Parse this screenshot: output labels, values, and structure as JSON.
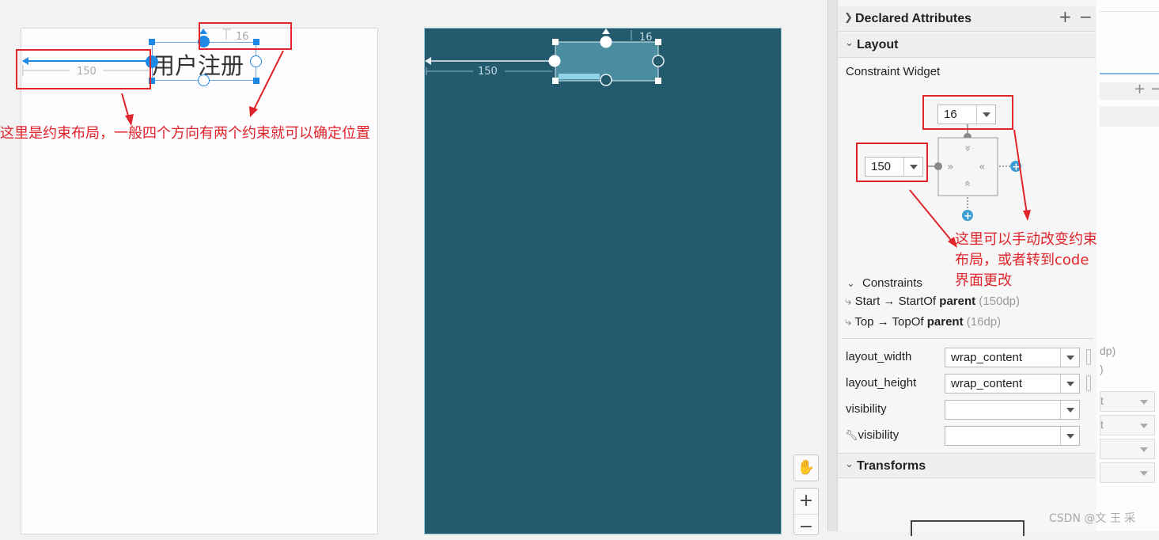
{
  "design": {
    "textview_text": "用户注册",
    "left_margin_value": "150",
    "top_margin_value": "16"
  },
  "annotations": {
    "left_note": "这里是约束布局，一般四个方向有两个约束就可以确定位置",
    "right_note_line1": "这里可以手动改变约束",
    "right_note_line2": "布局，或者转到code",
    "right_note_line3": "界面更改"
  },
  "panel": {
    "declared_attributes_title": "Declared Attributes",
    "layout_title": "Layout",
    "constraint_widget_label": "Constraint Widget",
    "top_margin_value": "16",
    "start_margin_value": "150",
    "constraints_title": "Constraints",
    "constraints": [
      {
        "prefix": "Start → StartOf ",
        "target": "parent",
        "suffix": " (150dp)"
      },
      {
        "prefix": "Top → TopOf ",
        "target": "parent",
        "suffix": " (16dp)"
      }
    ],
    "attributes": [
      {
        "name": "layout_width",
        "value": "wrap_content"
      },
      {
        "name": "layout_height",
        "value": "wrap_content"
      },
      {
        "name": "visibility",
        "value": ""
      },
      {
        "name": "visibility",
        "value": ""
      }
    ],
    "transforms_title": "Transforms"
  },
  "toolbar": {
    "plus": "+",
    "minus": "−"
  },
  "right_strip": {
    "partial_dp_1": "dp)",
    "partial_dp_2": ")",
    "partial_t1": "t",
    "partial_t2": "t"
  },
  "watermark": "CSDN @文 王 采",
  "colors": {
    "annotation_red": "#e0242b",
    "blueprint_bg": "#235a6e",
    "selection_blue": "#1e88e5",
    "constraint_blue": "#3b9dd1"
  }
}
